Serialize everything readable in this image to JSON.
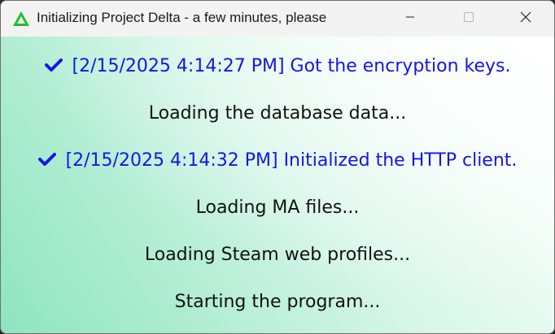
{
  "window": {
    "title": "Initializing Project Delta - a few minutes, please",
    "app_icon": "delta-logo-icon",
    "controls": {
      "minimize_icon": "minimize-icon",
      "maximize_icon": "maximize-icon",
      "close_icon": "close-icon"
    }
  },
  "status_lines": [
    {
      "text": "[2/15/2025 4:14:27 PM] Got the encryption keys.",
      "done": true,
      "icon": "checkmark-icon"
    },
    {
      "text": "Loading the database data...",
      "done": false
    },
    {
      "text": "[2/15/2025 4:14:32 PM] Initialized the HTTP client.",
      "done": true,
      "icon": "checkmark-icon"
    },
    {
      "text": "Loading MA files...",
      "done": false
    },
    {
      "text": "Loading Steam web profiles...",
      "done": false
    },
    {
      "text": "Starting the program...",
      "done": false
    }
  ],
  "colors": {
    "done_text": "#1515e6",
    "pending_text": "#111111",
    "logo_green": "#1fbf2e"
  }
}
